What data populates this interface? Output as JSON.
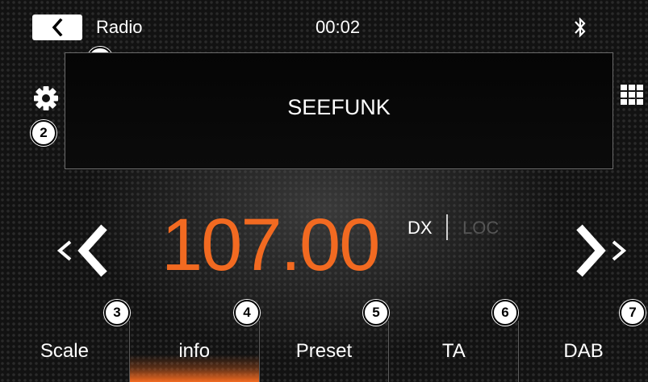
{
  "header": {
    "title": "Radio",
    "time": "00:02"
  },
  "station": {
    "name": "SEEFUNK"
  },
  "frequency": {
    "value": "107.00",
    "mode_dx": "DX",
    "mode_loc": "LOC",
    "active_mode": "DX"
  },
  "tabs": [
    {
      "label": "Scale",
      "callout": "3"
    },
    {
      "label": "info",
      "callout": "4",
      "active": true
    },
    {
      "label": "Preset",
      "callout": "5"
    },
    {
      "label": "TA",
      "callout": "6"
    },
    {
      "label": "DAB",
      "callout": "7"
    }
  ],
  "callouts": {
    "station": "1",
    "settings": "2"
  },
  "colors": {
    "accent": "#f26a21",
    "background": "#121212",
    "frame_border": "#6a6a6a",
    "inactive_text": "#555555"
  },
  "icons": [
    "back-icon",
    "bluetooth-icon",
    "gear-icon",
    "grid-icon",
    "seek-back-icon",
    "seek-forward-icon"
  ]
}
